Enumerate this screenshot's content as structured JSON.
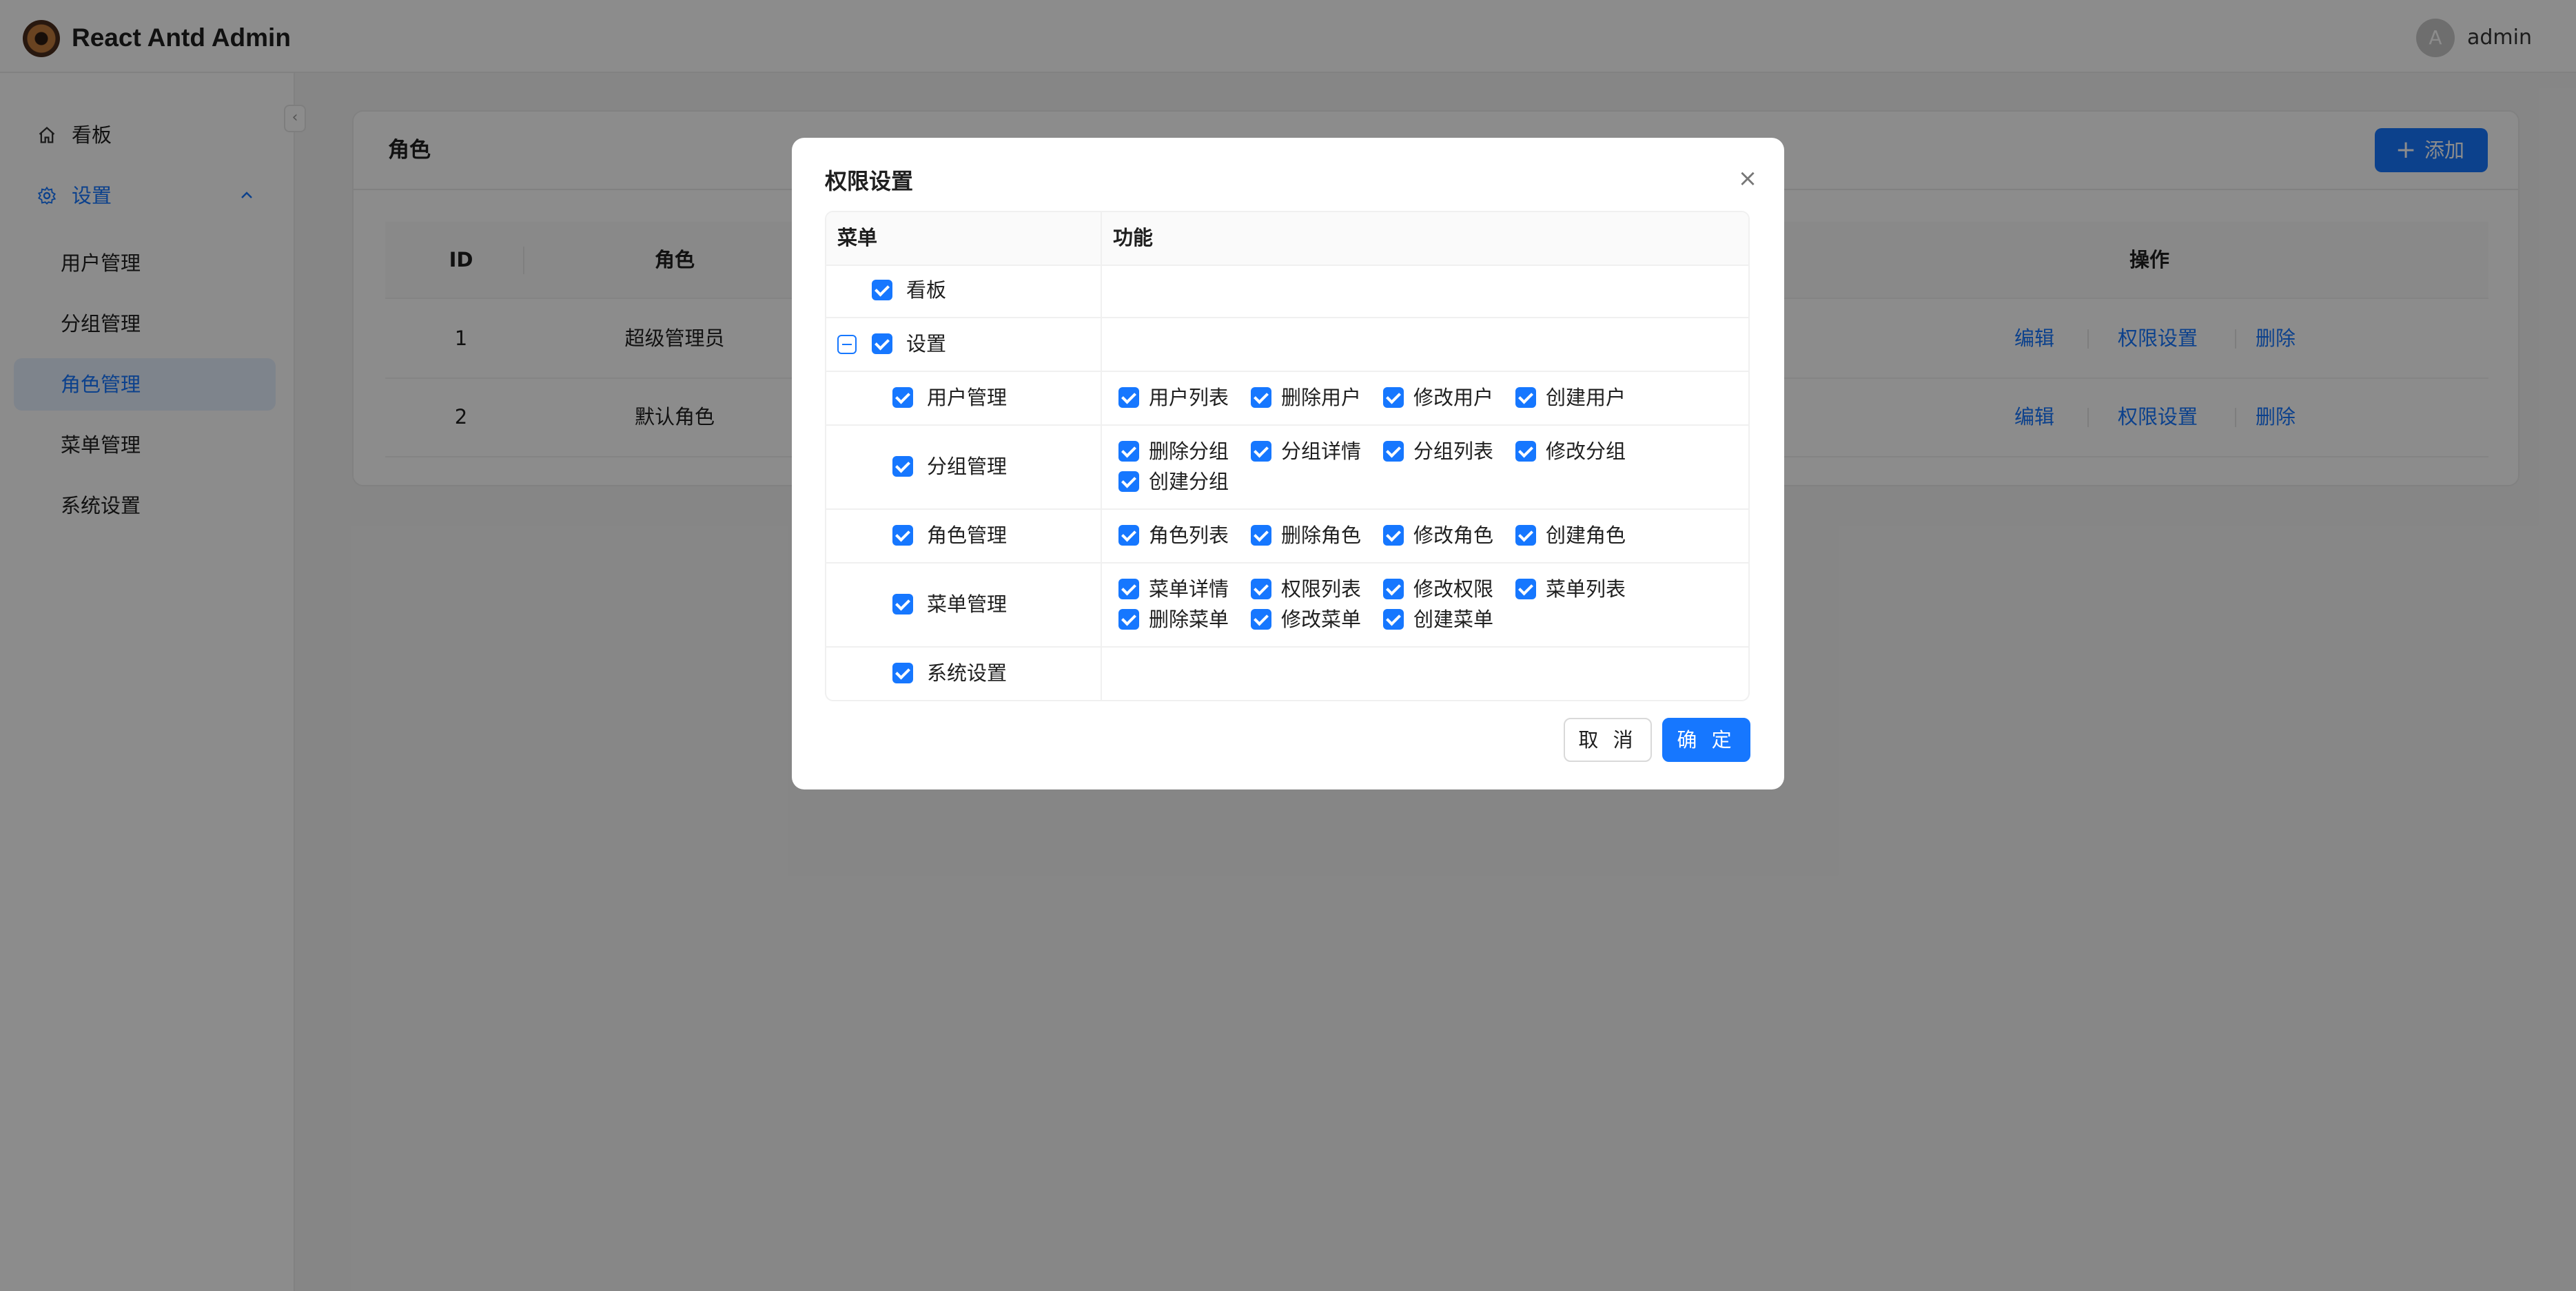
{
  "header": {
    "app_title": "React Antd Admin",
    "avatar_letter": "A",
    "username": "admin"
  },
  "sidebar": {
    "items": [
      {
        "label": "看板",
        "icon": "home-icon"
      },
      {
        "label": "设置",
        "icon": "gear-icon",
        "expanded": true
      },
      {
        "label": "用户管理"
      },
      {
        "label": "分组管理"
      },
      {
        "label": "角色管理",
        "active": true
      },
      {
        "label": "菜单管理"
      },
      {
        "label": "系统设置"
      }
    ]
  },
  "page": {
    "title": "角色",
    "add_button": "添加",
    "table": {
      "headers": [
        "ID",
        "角色",
        "操作"
      ],
      "rows": [
        {
          "id": "1",
          "role": "超级管理员",
          "actions": [
            "编辑",
            "权限设置",
            "删除"
          ]
        },
        {
          "id": "2",
          "role": "默认角色",
          "actions": [
            "编辑",
            "权限设置",
            "删除"
          ]
        }
      ]
    }
  },
  "modal": {
    "title": "权限设置",
    "col_menu": "菜单",
    "col_function": "功能",
    "rows": [
      {
        "menu": "看板",
        "functions": []
      },
      {
        "menu": "设置",
        "functions": []
      },
      {
        "menu": "用户管理",
        "functions": [
          "用户列表",
          "删除用户",
          "修改用户",
          "创建用户"
        ]
      },
      {
        "menu": "分组管理",
        "functions": [
          "删除分组",
          "分组详情",
          "分组列表",
          "修改分组",
          "创建分组"
        ]
      },
      {
        "menu": "角色管理",
        "functions": [
          "角色列表",
          "删除角色",
          "修改角色",
          "创建角色"
        ]
      },
      {
        "menu": "菜单管理",
        "functions": [
          "菜单详情",
          "权限列表",
          "修改权限",
          "菜单列表",
          "删除菜单",
          "修改菜单",
          "创建菜单"
        ]
      },
      {
        "menu": "系统设置",
        "functions": []
      }
    ],
    "cancel": "取 消",
    "ok": "确 定"
  },
  "colors": {
    "primary": "#1677ff",
    "active_bg": "#e6f0ff"
  }
}
